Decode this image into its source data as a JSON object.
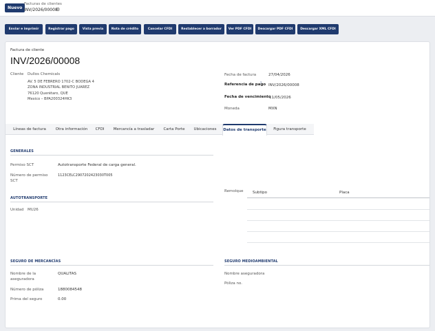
{
  "topbar": {
    "new_label": "Nuevo",
    "breadcrumb_parent": "Facturas de clientes",
    "breadcrumb_current": "INV/2026/00008",
    "gear_glyph": "⚙"
  },
  "actions": [
    "Enviar e imprimir",
    "Registrar pago",
    "Vista previa",
    "Nota de crédito",
    "Cancelar CFDI",
    "Restablecer a borrador",
    "Ver PDF CFDI",
    "Descargar PDF CFDI",
    "Descargar XML CFDI"
  ],
  "header": {
    "doc_type": "Factura de cliente",
    "number": "INV/2026/00008"
  },
  "customer": {
    "label": "Cliente",
    "name": "Dullos Chemicals",
    "address": [
      "AV. 5 DE FEBRERO 1702-C BODEGA 4",
      "ZONA INDUSTRIAL BENITO JUAREZ",
      "76120 Querétaro, QUE",
      "Mexico – BPA200324HK3"
    ]
  },
  "invoice_info": {
    "date_label": "Fecha de factura",
    "date_value": "27/04/2026",
    "payment_ref_label": "Referencia de pago",
    "payment_ref_marker": "?",
    "payment_ref_value": "INV/2026/00008",
    "due_label": "Fecha de vencimiento",
    "due_value": "11/05/2026",
    "currency_label": "Moneda",
    "currency_value": "MXN"
  },
  "tabs": [
    "Líneas de factura",
    "Otra información",
    "CFDI",
    "Mercancía a trasladar",
    "Carta Porte",
    "Ubicaciones",
    "Datos de transporte",
    "Figura transporte"
  ],
  "generales": {
    "title": "GENERALES",
    "permiso_label": "Permiso SCT",
    "permiso_value": "Autotransporte Federal de carga general.",
    "numero_label_1": "Número de permiso",
    "numero_label_2": "SCT",
    "numero_value": "1123CELC2907202423030T005"
  },
  "autotransporte": {
    "title": "AUTOTRANSPORTE",
    "unidad_label": "Unidad",
    "unidad_value": "MU26"
  },
  "remolque": {
    "label": "Remolque",
    "col_subtipo": "Subtipo",
    "col_placa": "Placa"
  },
  "seguro_mercancias": {
    "title": "SEGURO DE MERCANCÍAS",
    "aseguradora_label_1": "Nombre de la",
    "aseguradora_label_2": "aseguradora",
    "aseguradora_value": "QUALITAS",
    "poliza_label": "Número de póliza",
    "poliza_value": "1880084548",
    "prima_label": "Prima del seguro",
    "prima_value": "0.00"
  },
  "seguro_medioambiental": {
    "title": "SEGURO MEDIOAMBIENTAL",
    "aseguradora_label": "Nombre aseguradora",
    "poliza_label": "Póliza no."
  },
  "colors": {
    "primary": "#1f3a6e",
    "background": "#eceef2"
  }
}
